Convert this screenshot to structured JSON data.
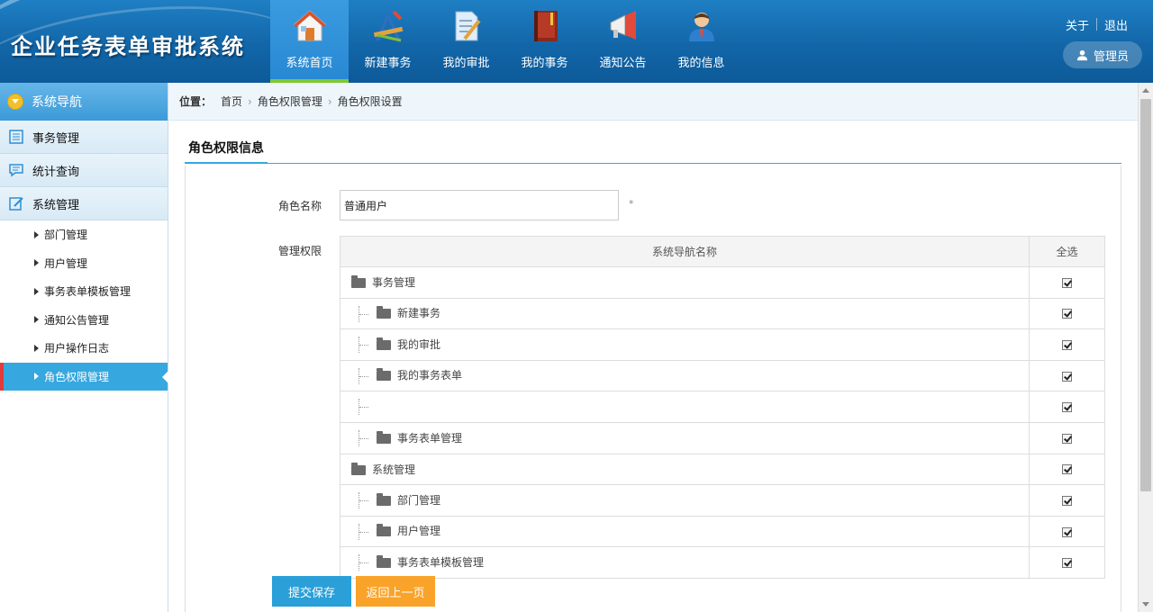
{
  "app": {
    "title": "企业任务表单审批系统"
  },
  "nav": [
    {
      "label": "系统首页",
      "icon": "home-icon",
      "active": true
    },
    {
      "label": "新建事务",
      "icon": "drafting-tools-icon"
    },
    {
      "label": "我的审批",
      "icon": "document-edit-icon"
    },
    {
      "label": "我的事务",
      "icon": "book-icon"
    },
    {
      "label": "通知公告",
      "icon": "megaphone-icon"
    },
    {
      "label": "我的信息",
      "icon": "user-icon"
    }
  ],
  "top_links": {
    "about": "关于",
    "logout": "退出"
  },
  "user": {
    "name": "管理员"
  },
  "sidebar": {
    "title": "系统导航",
    "groups": [
      {
        "label": "事务管理",
        "icon": "list-icon"
      },
      {
        "label": "统计查询",
        "icon": "chat-icon"
      },
      {
        "label": "系统管理",
        "icon": "edit-icon"
      }
    ],
    "sub_items": [
      {
        "label": "部门管理"
      },
      {
        "label": "用户管理"
      },
      {
        "label": "事务表单模板管理"
      },
      {
        "label": "通知公告管理"
      },
      {
        "label": "用户操作日志"
      },
      {
        "label": "角色权限管理",
        "active": true
      }
    ]
  },
  "breadcrumb": {
    "label": "位置：",
    "items": [
      "首页",
      "角色权限管理",
      "角色权限设置"
    ]
  },
  "section": {
    "title": "角色权限信息"
  },
  "form": {
    "role_name_label": "角色名称",
    "role_name_value": "普通用户",
    "required_mark": "*",
    "permission_label": "管理权限"
  },
  "table": {
    "headers": [
      "系统导航名称",
      "全选"
    ],
    "rows": [
      {
        "name": "事务管理",
        "level": 0,
        "checked": true
      },
      {
        "name": "新建事务",
        "level": 1,
        "checked": true
      },
      {
        "name": "我的审批",
        "level": 1,
        "checked": true
      },
      {
        "name": "我的事务表单",
        "level": 1,
        "checked": true
      },
      {
        "name": "",
        "level": 1,
        "checked": true
      },
      {
        "name": "事务表单管理",
        "level": 1,
        "checked": true
      },
      {
        "name": "系统管理",
        "level": 0,
        "checked": true
      },
      {
        "name": "部门管理",
        "level": 1,
        "checked": true
      },
      {
        "name": "用户管理",
        "level": 1,
        "checked": true
      },
      {
        "name": "事务表单模板管理",
        "level": 1,
        "checked": true
      }
    ]
  },
  "buttons": {
    "submit": "提交保存",
    "back": "返回上一页"
  },
  "colors": {
    "header": "#1266a8",
    "accent": "#37a7df",
    "submit": "#2a9fd8",
    "back": "#f9a32a"
  }
}
